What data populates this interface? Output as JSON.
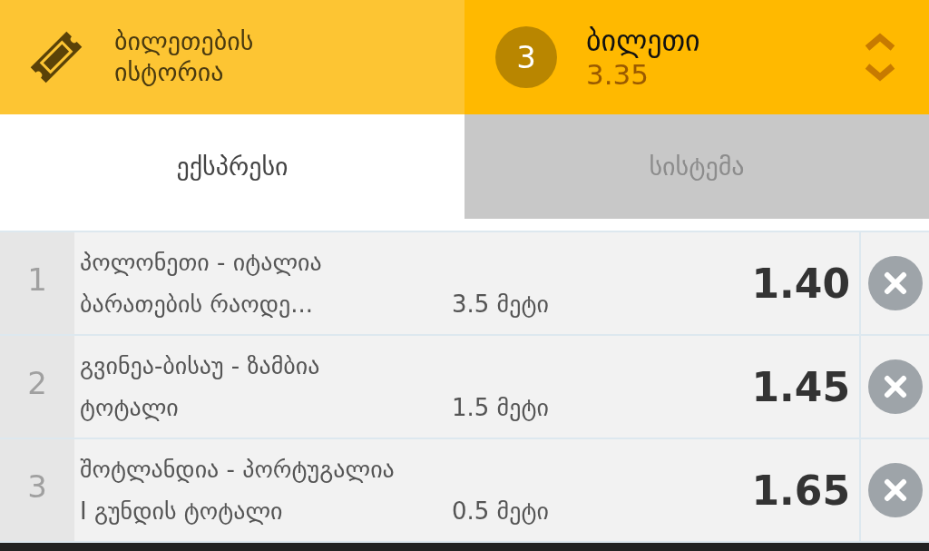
{
  "header": {
    "history_label": "ბილეთების\nისტორია",
    "ticket": {
      "count": "3",
      "title": "ბილეთი",
      "total": "3.35"
    }
  },
  "tabs": [
    {
      "label": "ექსპრესი",
      "selected": true
    },
    {
      "label": "სისტემა",
      "selected": false
    }
  ],
  "bets": [
    {
      "number": "1",
      "match": "პოლონეთი - იტალია",
      "market": "ბარათების რაოდე...",
      "pick": "3.5 მეტი",
      "odds": "1.40"
    },
    {
      "number": "2",
      "match": "გვინეა-ბისაუ - ზამბია",
      "market": "ტოტალი",
      "pick": "1.5 მეტი",
      "odds": "1.45"
    },
    {
      "number": "3",
      "match": "შოტლანდია - პორტუგალია",
      "market": "I გუნდის ტოტალი",
      "pick": "0.5 მეტი",
      "odds": "1.65"
    }
  ]
}
